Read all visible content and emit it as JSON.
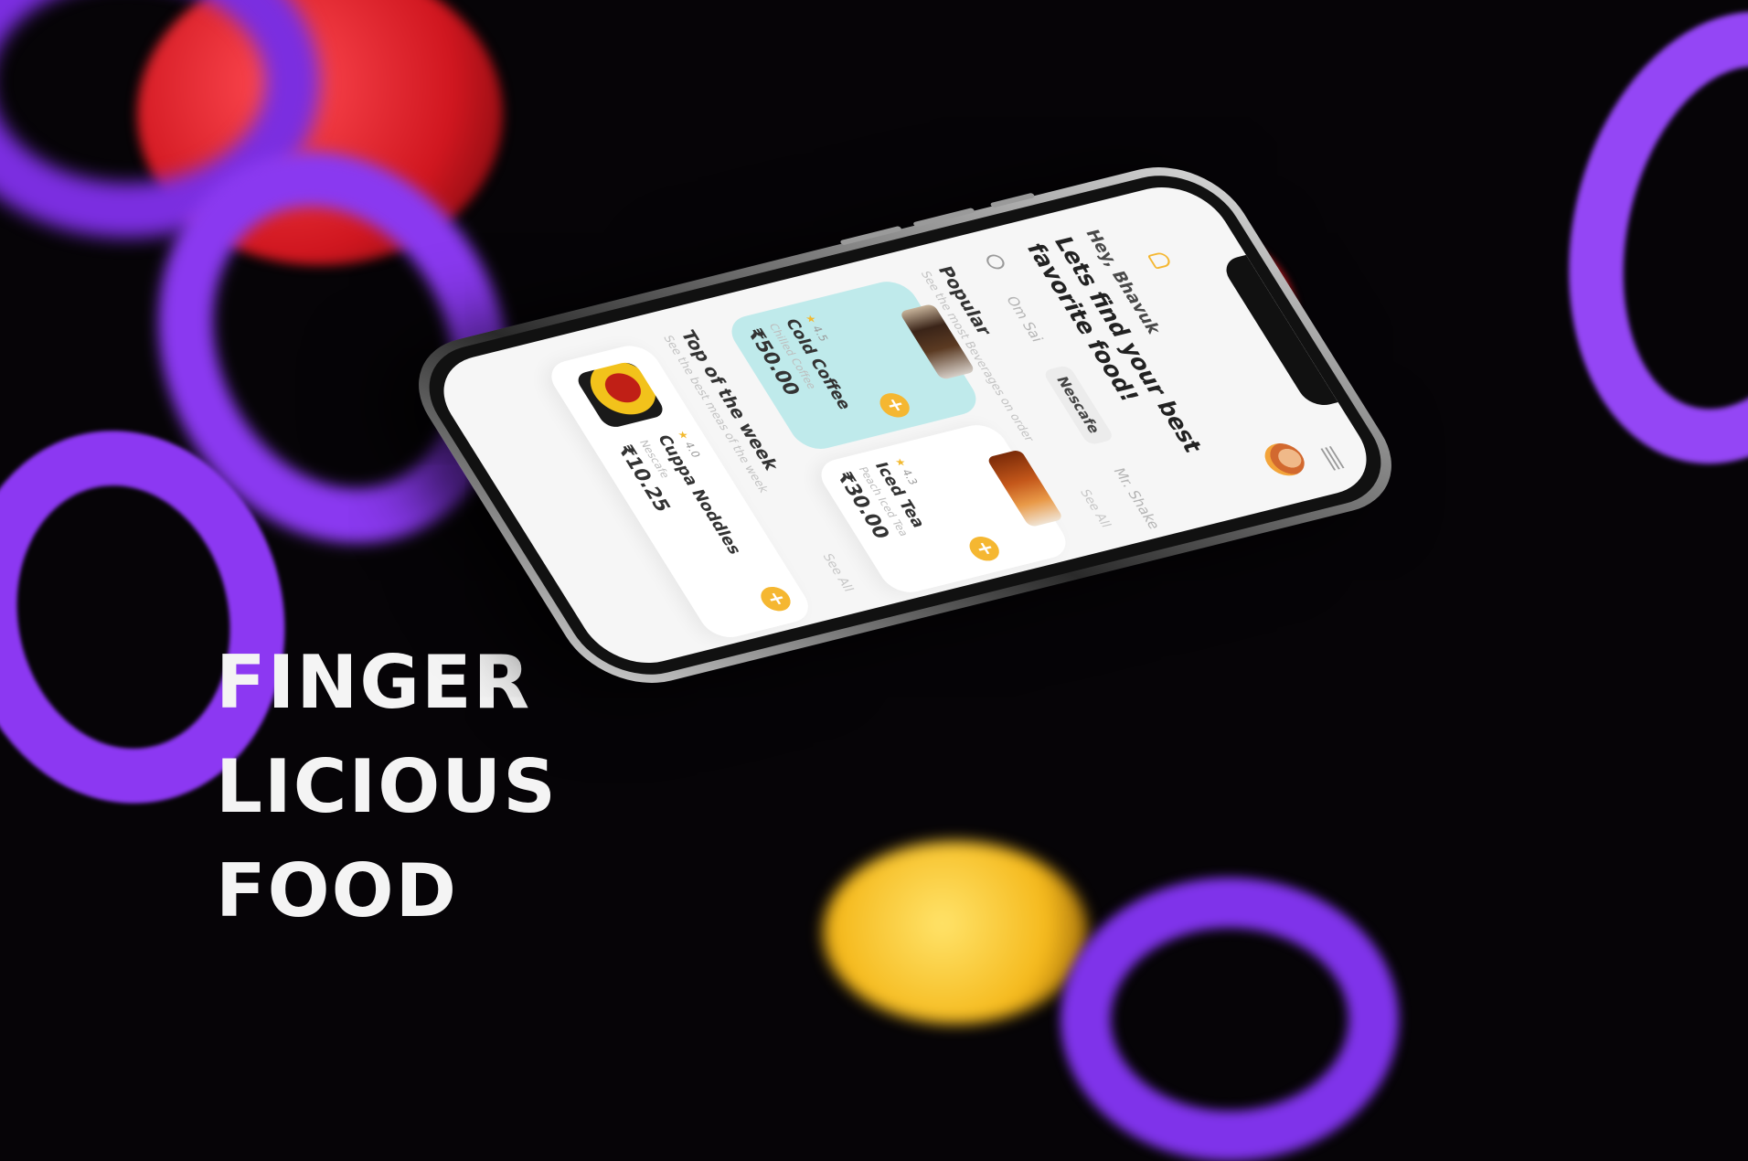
{
  "poster": {
    "headline": [
      "FINGER",
      "LICIOUS",
      "FOOD"
    ]
  },
  "colors": {
    "background": "#060407",
    "accent_yellow": "#f5b731",
    "card_teal": "#bfeaeb",
    "torus_purple": "#8a3cf0",
    "sphere_red": "#e1262e"
  },
  "app": {
    "greeting": "Hey, Bhavuk",
    "title": "Lets find your best favorite food!",
    "search_icon": "search-icon",
    "menu_icon": "hamburger-menu-icon",
    "bell_icon": "bell-icon",
    "chips": [
      "Om Sai",
      "Nescafe",
      "Mr. Shake"
    ],
    "active_chip": "Nescafe",
    "popular": {
      "title": "Popular",
      "subtitle": "See the most Beverages on order",
      "see_all": "See All",
      "items": [
        {
          "name": "Cold Coffee",
          "desc": "Chilled Coffee",
          "rating": "4.5",
          "price": "₹50.00"
        },
        {
          "name": "Iced Tea",
          "desc": "Peach Iced Tea",
          "rating": "4.3",
          "price": "₹30.00"
        }
      ]
    },
    "top_week": {
      "title": "Top of the week",
      "subtitle": "See the best meas of the week",
      "see_all": "See All",
      "items": [
        {
          "name": "Cuppa Noddles",
          "desc": "Nescafe",
          "rating": "4.0",
          "price": "₹10.25"
        }
      ]
    },
    "add_symbol": "+"
  }
}
